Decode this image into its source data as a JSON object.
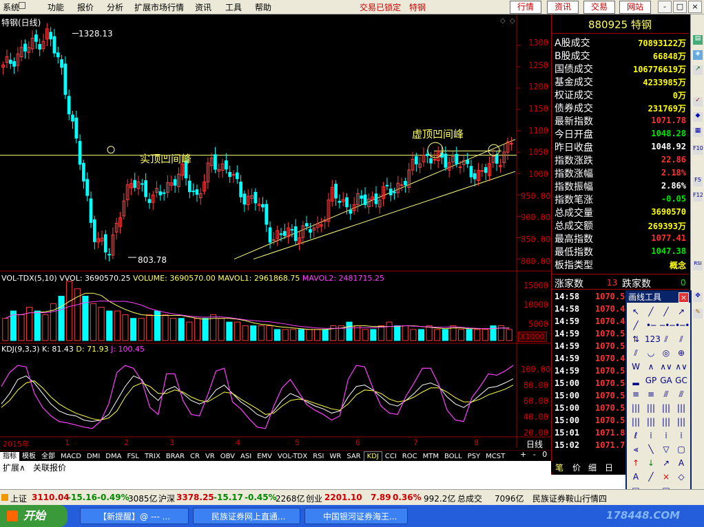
{
  "menu": {
    "items": [
      "系统",
      "功能",
      "报价",
      "分析",
      "扩展市场行情",
      "资讯",
      "工具",
      "帮助"
    ],
    "status": "交易已锁定",
    "stock_title": "特钢",
    "buttons": [
      "行情",
      "资讯",
      "交易",
      "网站"
    ],
    "window_controls": [
      "-",
      "□",
      "×"
    ]
  },
  "chart_header": {
    "name": "特钢(日线)"
  },
  "price_chart": {
    "yticks": [
      "1300",
      "1250",
      "1200",
      "1150",
      "1100",
      "1050",
      "1000",
      "950.00",
      "900.00",
      "850.00",
      "800.00"
    ],
    "high_label": "1328.13",
    "low_label": "803.78",
    "annotation_left": "实顶凹间峰",
    "annotation_right": "虚顶凹间峰"
  },
  "volume_chart": {
    "header": {
      "label": "VOL-TDX(5,10)",
      "vvol": "VVOL: 3690570.25",
      "volume": "VOLUME: 3690570.00",
      "mavol1": "MAVOL1: 2961868.75",
      "mavol2": "MAVOL2: 2481715.25"
    },
    "yticks": [
      "15000",
      "10000",
      "5000"
    ],
    "unit": "X1000"
  },
  "kdj_chart": {
    "header": {
      "label": "KDJ(9,3,3)",
      "k": "K: 81.43",
      "d": "D: 71.93",
      "j": "J: 100.45"
    },
    "yticks": [
      "100.00",
      "80.00",
      "60.00",
      "40.00",
      "20.00"
    ]
  },
  "date_axis": {
    "labels": [
      "2015年",
      "1",
      "2",
      "3",
      "4",
      "5",
      "6",
      "7",
      "8"
    ],
    "period": "日线"
  },
  "indicator_tabs": [
    "指标",
    "模板",
    "全部",
    "MACD",
    "DMI",
    "DMA",
    "FSL",
    "TRIX",
    "BRAR",
    "CR",
    "VR",
    "OBV",
    "ASI",
    "EMV",
    "VOL-TDX",
    "RSI",
    "WR",
    "SAR",
    "KDJ",
    "CCI",
    "ROC",
    "MTM",
    "BOLL",
    "PSY",
    "MCST"
  ],
  "indicator_tabs_right": [
    "+",
    "-",
    "0"
  ],
  "sub_tabs": [
    "扩展∧",
    "关联报价"
  ],
  "right_panel": {
    "code": "880925",
    "name": "特钢",
    "rows": [
      {
        "label": "A股成交",
        "value": "70893122万",
        "color": "#ffff00"
      },
      {
        "label": "B股成交",
        "value": "66848万",
        "color": "#ffff00"
      },
      {
        "label": "国债成交",
        "value": "106776619万",
        "color": "#ffff00"
      },
      {
        "label": "基金成交",
        "value": "4233985万",
        "color": "#ffff00"
      },
      {
        "label": "权证成交",
        "value": "0万",
        "color": "#ffff00"
      },
      {
        "label": "债券成交",
        "value": "231769万",
        "color": "#ffff00"
      },
      {
        "label": "最新指数",
        "value": "1071.78",
        "color": "#ff3232"
      },
      {
        "label": "今日开盘",
        "value": "1048.28",
        "color": "#00e600"
      },
      {
        "label": "昨日收盘",
        "value": "1048.92",
        "color": "#ffffff"
      },
      {
        "label": "指数涨跌",
        "value": "22.86",
        "color": "#ff3232"
      },
      {
        "label": "指数涨幅",
        "value": "2.18%",
        "color": "#ff3232"
      },
      {
        "label": "指数振幅",
        "value": "2.86%",
        "color": "#ffffff"
      },
      {
        "label": "指数笔涨",
        "value": "-0.05",
        "color": "#00e600"
      },
      {
        "label": "总成交量",
        "value": "3690570",
        "color": "#ffff00"
      },
      {
        "label": "总成交额",
        "value": "269393万",
        "color": "#ffff00"
      },
      {
        "label": "最高指数",
        "value": "1077.41",
        "color": "#ff3232"
      },
      {
        "label": "最低指数",
        "value": "1047.38",
        "color": "#00e600"
      },
      {
        "label": "板指类型",
        "value": "概念",
        "color": "#ffff00"
      }
    ],
    "rise_label": "涨家数",
    "rise_value": "13",
    "fall_label": "跌家数",
    "fall_value": "0",
    "ticks": [
      {
        "time": "14:58",
        "price": "1070.5"
      },
      {
        "time": "14:58",
        "price": "1070.4"
      },
      {
        "time": "14:59",
        "price": "1070.4"
      },
      {
        "time": "14:59",
        "price": "1070.5"
      },
      {
        "time": "14:59",
        "price": "1070.5"
      },
      {
        "time": "14:59",
        "price": "1070.4"
      },
      {
        "time": "14:59",
        "price": "1070.5"
      },
      {
        "time": "15:00",
        "price": "1070.5"
      },
      {
        "time": "15:00",
        "price": "1070.5"
      },
      {
        "time": "15:00",
        "price": "1070.5"
      },
      {
        "time": "15:00",
        "price": "1070.5"
      },
      {
        "time": "15:01",
        "price": "1071.8"
      },
      {
        "time": "15:02",
        "price": "1071.7"
      }
    ],
    "bottom_tabs": [
      "笔",
      "价",
      "细",
      "日"
    ]
  },
  "draw_tool": {
    "title": "画线工具",
    "close": "×",
    "tools": [
      "↖",
      "╱",
      "╱",
      "↗",
      "╱",
      "•─",
      "─•─",
      "•─•",
      "⇅",
      "123",
      "⫽",
      "⫽",
      "⫽",
      "◡",
      "◎",
      "⊕",
      "W",
      "∧",
      "∧∨",
      "∧∨",
      "▂",
      "GP",
      "GA",
      "GC",
      "≡",
      "≡",
      "⫻",
      "⫻",
      "|||",
      "|||",
      "|||",
      "|||",
      "|||",
      "|||",
      "|||",
      "|||",
      "ℓ",
      "⁞",
      "⁞",
      "⁞",
      "⫷",
      "╲",
      "▽",
      "▢",
      "↑",
      "↓",
      "↗",
      "A",
      "A",
      "╱",
      "×",
      "◇",
      "▤",
      "▭",
      "▣",
      ""
    ]
  },
  "status_bar": {
    "sh_label": "上证",
    "sh_value": "3110.04",
    "sh_change": "-15.16",
    "sh_pct": "-0.49%",
    "sh_amount": "3085亿",
    "sz_label": "沪深",
    "sz_value": "3378.25",
    "sz_change": "-15.17",
    "sz_pct": "-0.45%",
    "sz_amount": "2268亿",
    "cy_label": "创业",
    "cy_value": "2201.10",
    "cy_change": "7.89",
    "cy_pct": "0.36%",
    "cy_amount": "992.2亿",
    "total_label": "总成交",
    "total_value": "7096亿",
    "broker": "民族证券鞍山行情四"
  },
  "taskbar": {
    "start": "开始",
    "tasks": [
      "【新提醒】@ --- ...",
      "民族证券网上直通...",
      "中国银河证券海王..."
    ],
    "watermark": "178448.COM"
  },
  "chart_data": {
    "type": "candlestick",
    "title": "特钢(日线)",
    "price_range": [
      780,
      1340
    ],
    "price_points": [
      {
        "x": "2015-01-05",
        "close": 1245
      },
      {
        "x": "2015-01-12",
        "close": 1282
      },
      {
        "x": "2015-01-19",
        "close": 1300
      },
      {
        "x": "2015-01-26",
        "close": 1328.13
      },
      {
        "x": "2015-02-02",
        "close": 1230
      },
      {
        "x": "2015-02-05",
        "close": 1050
      },
      {
        "x": "2015-02-09",
        "close": 870
      },
      {
        "x": "2015-02-12",
        "close": 803.78
      },
      {
        "x": "2015-02-16",
        "close": 940
      },
      {
        "x": "2015-02-25",
        "close": 985
      },
      {
        "x": "2015-03-03",
        "close": 935
      },
      {
        "x": "2015-03-10",
        "close": 975
      },
      {
        "x": "2015-03-17",
        "close": 1000
      },
      {
        "x": "2015-03-24",
        "close": 945
      },
      {
        "x": "2015-03-31",
        "close": 1030
      },
      {
        "x": "2015-04-08",
        "close": 1010
      },
      {
        "x": "2015-04-15",
        "close": 950
      },
      {
        "x": "2015-04-22",
        "close": 935
      },
      {
        "x": "2015-05-05",
        "close": 850
      },
      {
        "x": "2015-05-12",
        "close": 860
      },
      {
        "x": "2015-05-19",
        "close": 865
      },
      {
        "x": "2015-05-26",
        "close": 870
      },
      {
        "x": "2015-06-02",
        "close": 950
      },
      {
        "x": "2015-06-09",
        "close": 925
      },
      {
        "x": "2015-06-16",
        "close": 935
      },
      {
        "x": "2015-06-23",
        "close": 945
      },
      {
        "x": "2015-06-30",
        "close": 960
      },
      {
        "x": "2015-07-06",
        "close": 990
      },
      {
        "x": "2015-07-13",
        "close": 1045
      },
      {
        "x": "2015-07-17",
        "close": 1030
      },
      {
        "x": "2015-07-24",
        "close": 1035
      },
      {
        "x": "2015-07-31",
        "close": 1010
      },
      {
        "x": "2015-08-06",
        "close": 1000
      },
      {
        "x": "2015-08-12",
        "close": 1030
      },
      {
        "x": "2015-08-17",
        "close": 1071.78
      }
    ],
    "resistance_level": 1043,
    "volume_series": [
      6,
      8,
      7,
      9,
      8,
      7,
      10,
      12,
      16,
      14,
      12,
      10,
      9,
      8,
      8,
      7,
      6,
      6,
      7,
      8,
      7,
      6,
      6,
      5,
      6,
      6,
      7,
      6,
      5,
      5,
      4,
      4,
      4,
      4,
      3,
      3,
      3,
      3,
      3,
      3,
      3,
      4,
      4,
      5,
      4,
      3,
      3,
      4,
      5,
      4,
      4,
      3,
      3,
      4,
      3,
      3,
      4,
      3,
      3,
      3,
      3,
      4,
      4,
      3
    ],
    "volume_unit": "X1000",
    "kdj": {
      "K": 81.43,
      "D": 71.93,
      "J": 100.45
    },
    "k_series": [
      45,
      60,
      80,
      85,
      75,
      60,
      45,
      35,
      30,
      28,
      22,
      20,
      22,
      30,
      50,
      70,
      85,
      80,
      60,
      50,
      65,
      70,
      60,
      50,
      45,
      50,
      65,
      72,
      60,
      48,
      40,
      30,
      25,
      35,
      50,
      60,
      55,
      48,
      42,
      38,
      32,
      35,
      55,
      70,
      72,
      65,
      55,
      45,
      42,
      50,
      60,
      72,
      75,
      70,
      55,
      45,
      40,
      48,
      58,
      68,
      70,
      75,
      81
    ],
    "d_series": [
      40,
      50,
      65,
      75,
      78,
      68,
      55,
      45,
      38,
      32,
      28,
      24,
      22,
      25,
      35,
      55,
      70,
      75,
      70,
      60,
      60,
      65,
      62,
      55,
      50,
      48,
      55,
      62,
      60,
      52,
      45,
      38,
      30,
      32,
      42,
      50,
      52,
      50,
      46,
      42,
      38,
      36,
      45,
      58,
      65,
      64,
      60,
      52,
      48,
      50,
      55,
      62,
      68,
      68,
      62,
      54,
      48,
      48,
      52,
      58,
      62,
      66,
      72
    ],
    "j_series": [
      70,
      90,
      100,
      98,
      60,
      40,
      28,
      20,
      18,
      15,
      12,
      10,
      20,
      45,
      90,
      100,
      96,
      78,
      40,
      30,
      88,
      88,
      50,
      30,
      28,
      58,
      92,
      96,
      48,
      38,
      24,
      12,
      10,
      42,
      68,
      80,
      62,
      44,
      36,
      30,
      22,
      28,
      80,
      100,
      98,
      68,
      42,
      32,
      30,
      56,
      75,
      96,
      96,
      72,
      36,
      22,
      20,
      54,
      70,
      88,
      86,
      92,
      100
    ],
    "kdj_range": [
      0,
      110
    ]
  }
}
